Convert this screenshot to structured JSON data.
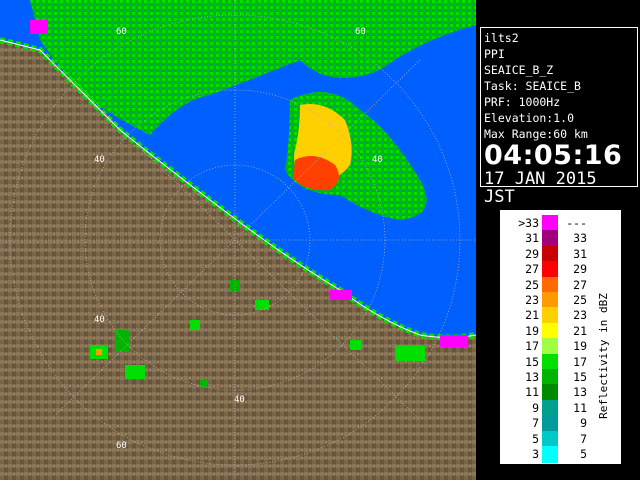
{
  "info": {
    "station": "ilts2",
    "scan_type": "PPI",
    "product": "SEAICE_B_Z",
    "task": "Task: SEAICE_B",
    "prf": "PRF: 1000Hz",
    "elevation": "Elevation:1.0",
    "max_range": "Max Range:60 km",
    "time": "04:05:16",
    "date": "17 JAN 2015 JST"
  },
  "range_labels": [
    "60",
    "60",
    "40",
    "40",
    "40",
    "40",
    "60"
  ],
  "legend": {
    "unit_label": "Reflectivity in dBZ",
    "rows": [
      {
        "left": ">33",
        "right": "---",
        "color": "#ff00ff"
      },
      {
        "left": "31",
        "right": "33",
        "color": "#a0007a"
      },
      {
        "left": "29",
        "right": "31",
        "color": "#c80000"
      },
      {
        "left": "27",
        "right": "29",
        "color": "#ff0000"
      },
      {
        "left": "25",
        "right": "27",
        "color": "#ff6a00"
      },
      {
        "left": "23",
        "right": "25",
        "color": "#ff9a00"
      },
      {
        "left": "21",
        "right": "23",
        "color": "#ffd000"
      },
      {
        "left": "19",
        "right": "21",
        "color": "#ffff00"
      },
      {
        "left": "17",
        "right": "19",
        "color": "#a0ff40"
      },
      {
        "left": "15",
        "right": "17",
        "color": "#00e000"
      },
      {
        "left": "13",
        "right": "15",
        "color": "#00b400"
      },
      {
        "left": "11",
        "right": "13",
        "color": "#008a00"
      },
      {
        "left": "9",
        "right": "11",
        "color": "#00a08c"
      },
      {
        "left": "7",
        "right": "9",
        "color": "#009a9a"
      },
      {
        "left": "5",
        "right": "7",
        "color": "#00c8c8"
      },
      {
        "left": "3",
        "right": "5",
        "color": "#00ffff"
      }
    ]
  },
  "colors": {
    "sea": "#0060ff",
    "land": "#7a6448",
    "range_ring": "#b0b0b0",
    "coast": "#ffffff"
  }
}
